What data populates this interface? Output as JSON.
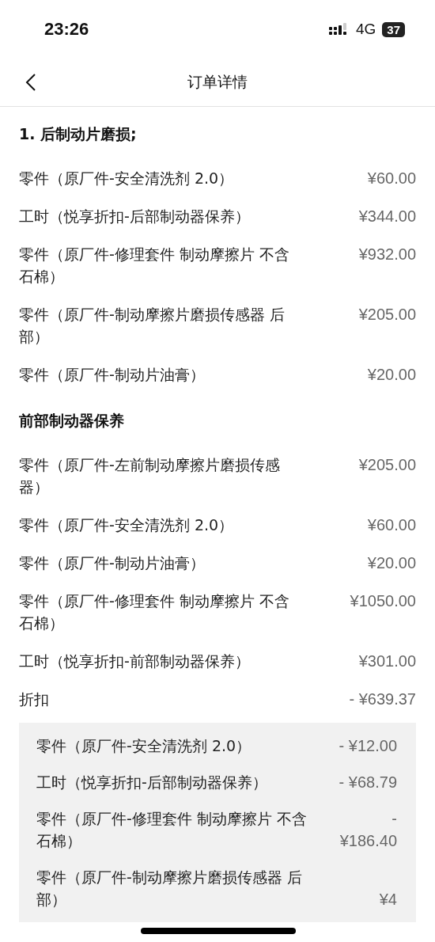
{
  "status_bar": {
    "time": "23:26",
    "network": "4G",
    "battery": "37"
  },
  "nav": {
    "title": "订单详情"
  },
  "sections": [
    {
      "title": "1. 后制动片磨损;",
      "items": [
        {
          "label": "零件（原厂件-安全清洗剂 2.0）",
          "amount": "¥60.00"
        },
        {
          "label": "工时（悦享折扣-后部制动器保养）",
          "amount": "¥344.00"
        },
        {
          "label": "零件（原厂件-修理套件 制动摩擦片 不含石棉）",
          "amount": "¥932.00"
        },
        {
          "label": "零件（原厂件-制动摩擦片磨损传感器 后部）",
          "amount": "¥205.00"
        },
        {
          "label": "零件（原厂件-制动片油膏）",
          "amount": "¥20.00"
        }
      ]
    },
    {
      "title": "前部制动器保养",
      "items": [
        {
          "label": "零件（原厂件-左前制动摩擦片磨损传感器）",
          "amount": "¥205.00"
        },
        {
          "label": "零件（原厂件-安全清洗剂 2.0）",
          "amount": "¥60.00"
        },
        {
          "label": "零件（原厂件-制动片油膏）",
          "amount": "¥20.00"
        },
        {
          "label": "零件（原厂件-修理套件 制动摩擦片 不含石棉）",
          "amount": "¥1050.00"
        },
        {
          "label": "工时（悦享折扣-前部制动器保养）",
          "amount": "¥301.00"
        }
      ]
    }
  ],
  "discount": {
    "label": "折扣",
    "amount": "- ¥639.37",
    "items": [
      {
        "label": "零件（原厂件-安全清洗剂 2.0）",
        "amount": "- ¥12.00"
      },
      {
        "label": "工时（悦享折扣-后部制动器保养）",
        "amount": "- ¥68.79"
      },
      {
        "label": "零件（原厂件-修理套件 制动摩擦片 不含石棉）",
        "amount": "- ¥186.40"
      },
      {
        "label": "零件（原厂件-制动摩擦片磨损传感器 后部）",
        "amount": "¥4"
      }
    ]
  }
}
